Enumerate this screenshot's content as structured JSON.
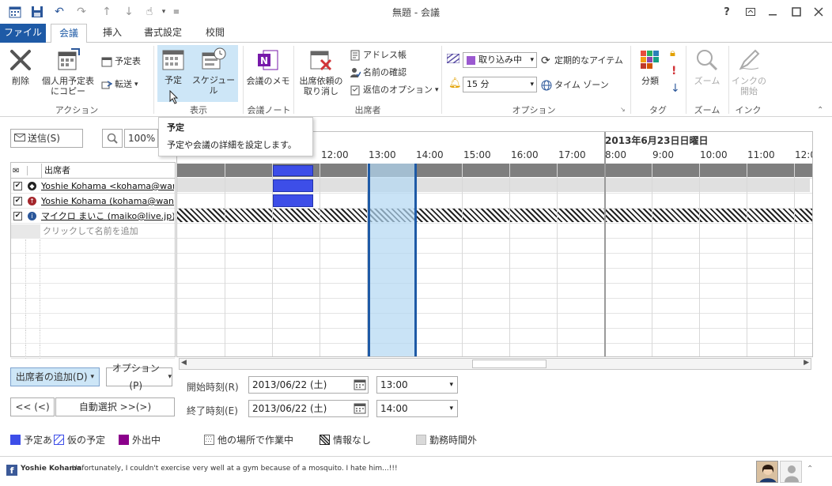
{
  "window": {
    "title": "無題 - 会議"
  },
  "tabs": [
    {
      "label": "ファイル"
    },
    {
      "label": "会議"
    },
    {
      "label": "挿入"
    },
    {
      "label": "書式設定"
    },
    {
      "label": "校閲"
    }
  ],
  "ribbon": {
    "action": {
      "label": "アクション",
      "delete": "削除",
      "copy1": "個人用予定表",
      "copy2": "にコピー",
      "calendar": "予定表",
      "forward": "転送"
    },
    "show": {
      "label": "表示",
      "appointment": "予定",
      "schedule": "スケジュール"
    },
    "notes": {
      "label": "会議ノート",
      "meeting_notes": "会議のメモ"
    },
    "attendees": {
      "label": "出席者",
      "cancel1": "出席依頼の",
      "cancel2": "取り消し",
      "address_book": "アドレス帳",
      "check_names": "名前の確認",
      "response_options": "返信のオプション"
    },
    "options": {
      "label": "オプション",
      "show_as": "取り込み中",
      "reminder": "15 分",
      "recurrence": "定期的なアイテム",
      "time_zones": "タイム ゾーン"
    },
    "tags": {
      "label": "タグ",
      "categorize": "分類"
    },
    "zoom": {
      "label": "ズーム",
      "zoom": "ズーム"
    },
    "ink": {
      "label": "インク",
      "start1": "インクの",
      "start2": "開始"
    }
  },
  "tooltip": {
    "title": "予定",
    "desc": "予定や会議の詳細を設定します。"
  },
  "toolbar": {
    "send": "送信(S)",
    "zoom": "100%"
  },
  "schedule": {
    "date_label": "2013年6月23日日曜日",
    "hours_day1": [
      "12:00",
      "13:00",
      "14:00",
      "15:00",
      "16:00",
      "17:00"
    ],
    "hours_day2": [
      "8:00",
      "9:00",
      "10:00",
      "11:00",
      "12:0"
    ]
  },
  "attendees": {
    "header": "出席者",
    "rows": [
      {
        "name": "Yoshie Kohama <kohama@wanich"
      },
      {
        "name": "Yoshie Kohama (kohama@wanich"
      },
      {
        "name": "マイクロ まいこ (maiko@live.jp)"
      }
    ],
    "add_placeholder": "クリックして名前を追加"
  },
  "controls": {
    "add_attendees": "出席者の追加(D)",
    "options": "オプション(P)",
    "prev": "<< (<)",
    "autopick": "自動選択 >>(>)",
    "start_label": "開始時刻(R)",
    "end_label": "終了時刻(E)",
    "start_date": "2013/06/22 (土)",
    "end_date": "2013/06/22 (土)",
    "start_time": "13:00",
    "end_time": "14:00"
  },
  "legend": [
    {
      "label": "予定あ",
      "color": "#3d4ee8"
    },
    {
      "label": "仮の予定"
    },
    {
      "label": "外出中",
      "color": "#8b008b"
    },
    {
      "label": "他の場所で作業中"
    },
    {
      "label": "情報なし"
    },
    {
      "label": "勤務時間外",
      "color": "#d9d9d9"
    }
  ],
  "status": {
    "user": "Yoshie Kohama",
    "message": "Unfortunately, I couldn't exercise very well at a gym because of a mosquito. I hate him...!!!"
  }
}
